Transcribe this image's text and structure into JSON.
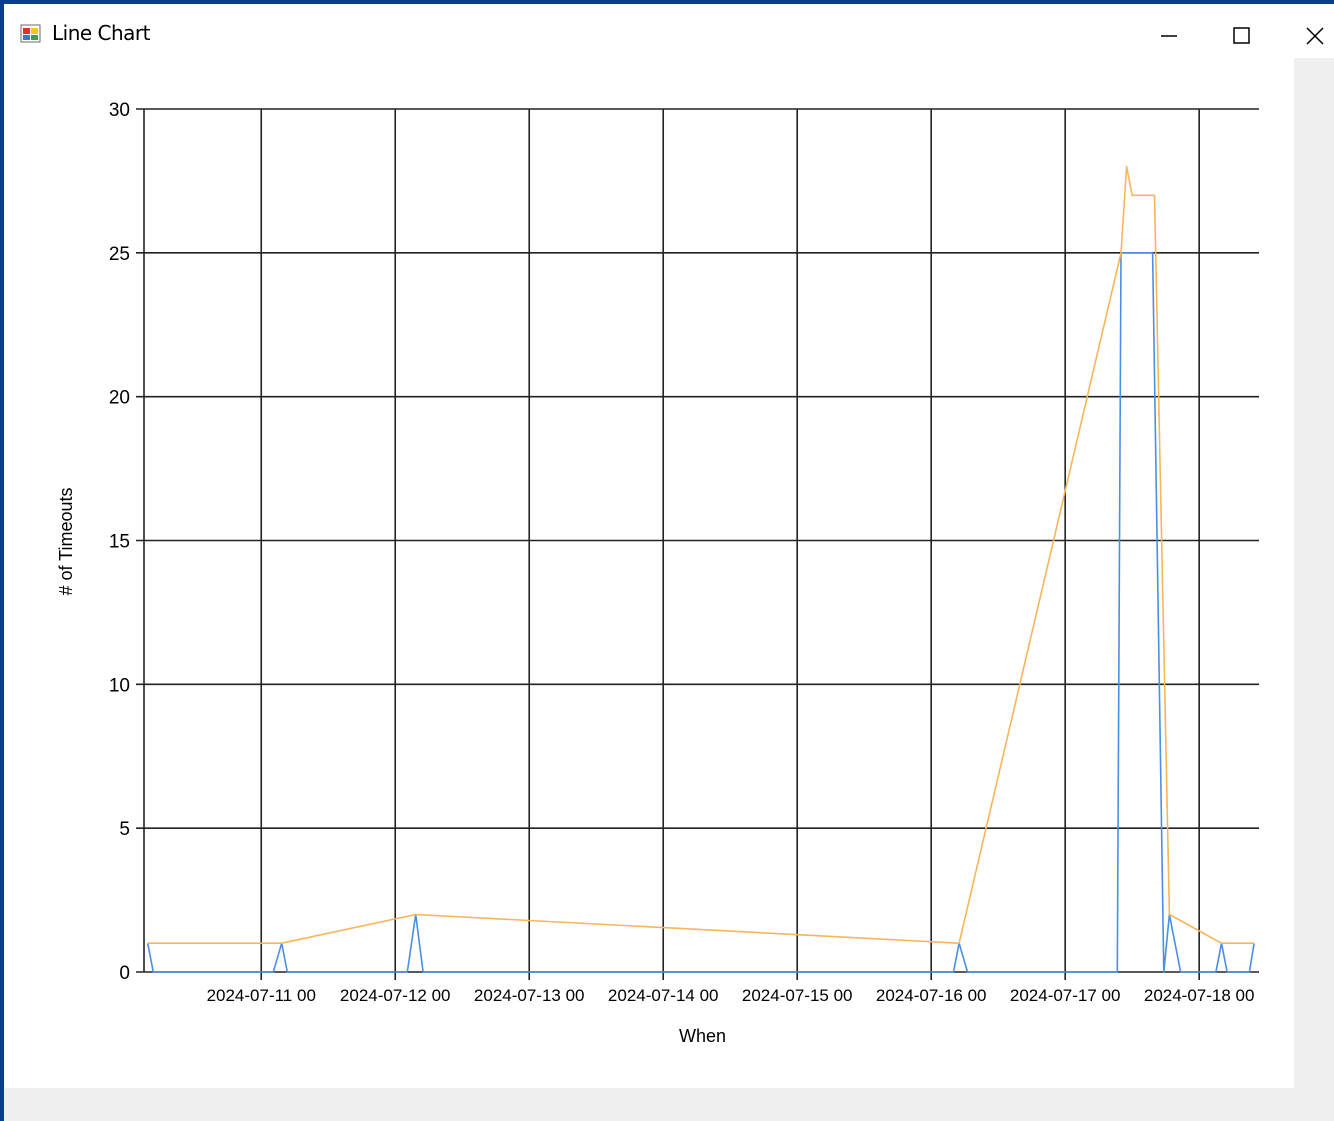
{
  "window": {
    "title": "Line Chart",
    "icon": "chart-app-icon"
  },
  "controls": {
    "minimize_icon": "minimize-icon",
    "maximize_icon": "maximize-icon",
    "close_icon": "close-icon"
  },
  "chart_data": {
    "type": "line",
    "title": "",
    "xlabel": "When",
    "ylabel": "# of Timeouts",
    "xlim": [
      "2024-07-10 03:00",
      "2024-07-18 10:00"
    ],
    "ylim": [
      0,
      30
    ],
    "yticks": [
      0,
      5,
      10,
      15,
      20,
      25,
      30
    ],
    "xticks": [
      {
        "at": "2024-07-11 00:00",
        "label": "2024-07-11 00"
      },
      {
        "at": "2024-07-12 00:00",
        "label": "2024-07-12 00"
      },
      {
        "at": "2024-07-13 00:00",
        "label": "2024-07-13 00"
      },
      {
        "at": "2024-07-14 00:00",
        "label": "2024-07-14 00"
      },
      {
        "at": "2024-07-15 00:00",
        "label": "2024-07-15 00"
      },
      {
        "at": "2024-07-16 00:00",
        "label": "2024-07-16 00"
      },
      {
        "at": "2024-07-17 00:00",
        "label": "2024-07-17 00"
      },
      {
        "at": "2024-07-18 00:00",
        "label": "2024-07-18 00"
      }
    ],
    "grid": true,
    "legend": "none",
    "series": [
      {
        "color": "#4a90e2",
        "points": [
          {
            "x": "2024-07-10 03:40",
            "y": 1
          },
          {
            "x": "2024-07-10 04:40",
            "y": 0
          },
          {
            "x": "2024-07-11 02:10",
            "y": 0
          },
          {
            "x": "2024-07-11 03:40",
            "y": 1
          },
          {
            "x": "2024-07-11 04:40",
            "y": 0
          },
          {
            "x": "2024-07-12 02:10",
            "y": 0
          },
          {
            "x": "2024-07-12 03:40",
            "y": 2
          },
          {
            "x": "2024-07-12 05:00",
            "y": 0
          },
          {
            "x": "2024-07-16 04:00",
            "y": 0
          },
          {
            "x": "2024-07-16 05:00",
            "y": 1
          },
          {
            "x": "2024-07-16 06:30",
            "y": 0
          },
          {
            "x": "2024-07-17 09:20",
            "y": 0
          },
          {
            "x": "2024-07-17 10:00",
            "y": 25
          },
          {
            "x": "2024-07-17 15:40",
            "y": 25
          },
          {
            "x": "2024-07-17 17:40",
            "y": 0
          },
          {
            "x": "2024-07-17 18:40",
            "y": 2
          },
          {
            "x": "2024-07-17 20:40",
            "y": 0
          },
          {
            "x": "2024-07-18 03:00",
            "y": 0
          },
          {
            "x": "2024-07-18 04:00",
            "y": 1
          },
          {
            "x": "2024-07-18 05:00",
            "y": 0
          },
          {
            "x": "2024-07-18 09:00",
            "y": 0
          },
          {
            "x": "2024-07-18 09:50",
            "y": 1
          }
        ]
      },
      {
        "color": "#f8b55a",
        "points": [
          {
            "x": "2024-07-10 03:40",
            "y": 1
          },
          {
            "x": "2024-07-11 03:40",
            "y": 1
          },
          {
            "x": "2024-07-12 03:40",
            "y": 2
          },
          {
            "x": "2024-07-16 05:00",
            "y": 1
          },
          {
            "x": "2024-07-17 10:00",
            "y": 25
          },
          {
            "x": "2024-07-17 11:00",
            "y": 28
          },
          {
            "x": "2024-07-17 12:00",
            "y": 27
          },
          {
            "x": "2024-07-17 16:00",
            "y": 27
          },
          {
            "x": "2024-07-17 18:40",
            "y": 2
          },
          {
            "x": "2024-07-18 04:00",
            "y": 1
          },
          {
            "x": "2024-07-18 09:50",
            "y": 1
          }
        ]
      }
    ]
  }
}
